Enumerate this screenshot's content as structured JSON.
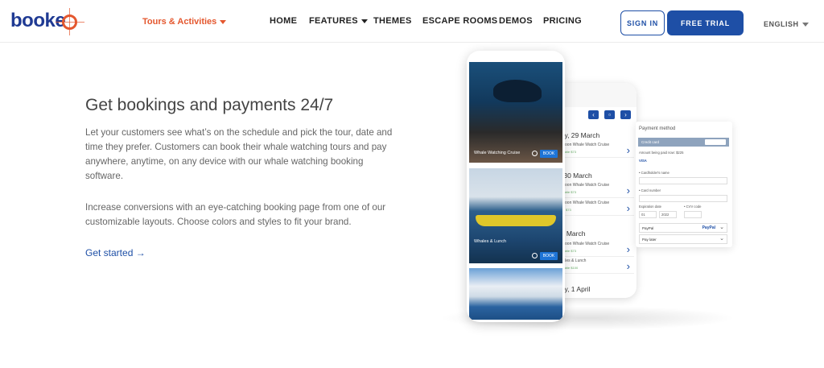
{
  "nav": {
    "logo": "booke",
    "tours_label": "Tours & Activities",
    "items": [
      {
        "label": "HOME"
      },
      {
        "label": "FEATURES"
      },
      {
        "label": "THEMES"
      },
      {
        "label": "ESCAPE ROOMS"
      },
      {
        "label": "DEMOS"
      },
      {
        "label": "PRICING"
      }
    ],
    "sign_in": "SIGN IN",
    "free_trial": "FREE TRIAL",
    "language": "ENGLISH"
  },
  "hero": {
    "title": "Get bookings and payments 24/7",
    "paragraph1": "Let your customers see what’s on the schedule and pick the tour, date and time they prefer. Customers can book their whale watching tours and pay anywhere, anytime, on any device with our whale watching booking software.",
    "paragraph2": "Increase conversions with an eye-catching booking page from one of our customizable layouts. Choose colors and styles to fit your brand.",
    "cta": "Get started →"
  },
  "mockup": {
    "tour1": "Whale Watching Cruise",
    "tour2": "Whales & Lunch",
    "book": "BOOK",
    "days": [
      "day, 29 March",
      "y, 30 March",
      "31 March",
      "day, 1 April"
    ],
    "rows": [
      {
        "title": "fternoon Whale Watch Cruise",
        "avail": "Available  $73"
      },
      {
        "title": "fternoon Whale Watch Cruise",
        "avail": "Available  $73"
      },
      {
        "title": "fternoon Whale Watch Cruise",
        "avail": "LAST  $73"
      },
      {
        "title": "fternoon Whale Watch Cruise",
        "avail": "Available  $73"
      },
      {
        "title": "fternoon Whale Watch Cruise",
        "avail": "Available  $73"
      },
      {
        "title": "Whales & Lunch",
        "avail": "Available  $100"
      }
    ],
    "payment_title": "Payment method",
    "credit_card": "Credit card",
    "amount_label": "Amount being paid now: $225",
    "cardholder": "• Cardholder's name",
    "card_number": "• Card number",
    "expiration": "Expiration date",
    "cvv": "• CVV code",
    "month": "01",
    "year": "2022",
    "paypal": "PayPal",
    "pay_later": "Pay later",
    "card_brands": "VISA"
  },
  "colors": {
    "brand_blue": "#1e4fa6",
    "accent_orange": "#e4572e"
  }
}
